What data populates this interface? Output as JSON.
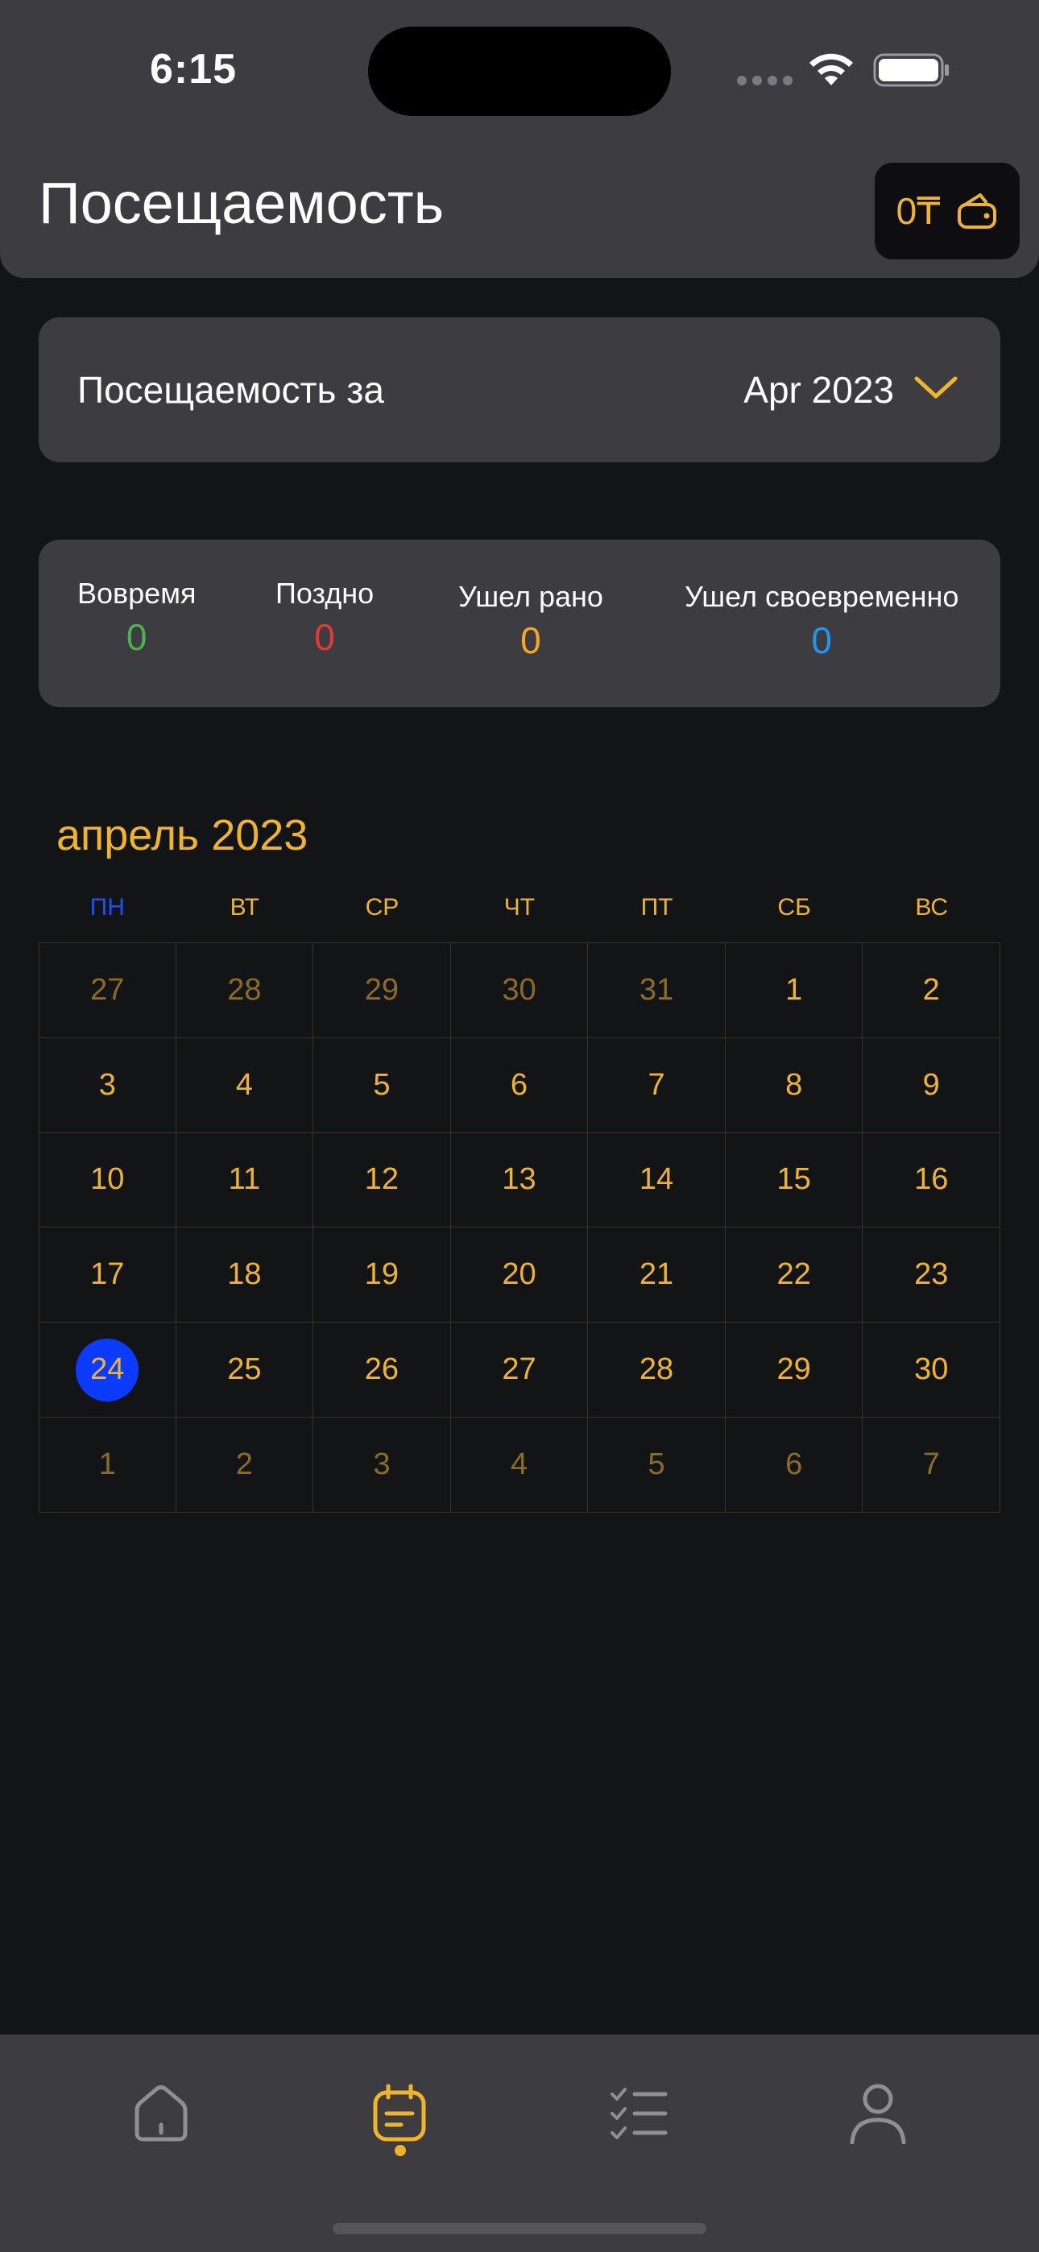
{
  "status_bar": {
    "time": "6:15"
  },
  "header": {
    "title": "Посещаемость",
    "wallet_amount": "0₸",
    "wallet_icon": "wallet-icon"
  },
  "period": {
    "label": "Посещаемость за",
    "value": "Apr 2023",
    "icon": "chevron-down-icon"
  },
  "stats": [
    {
      "label": "Вовремя",
      "value": "0",
      "color": "#4caf50"
    },
    {
      "label": "Поздно",
      "value": "0",
      "color": "#e53935"
    },
    {
      "label": "Ушел рано",
      "value": "0",
      "color": "#f5a623"
    },
    {
      "label": "Ушел своевременно",
      "value": "0",
      "color": "#2196f3"
    }
  ],
  "calendar": {
    "title": "апрель 2023",
    "weekdays": [
      "ПН",
      "ВТ",
      "СР",
      "ЧТ",
      "ПТ",
      "СБ",
      "ВС"
    ],
    "days": [
      {
        "d": "27",
        "dim": true
      },
      {
        "d": "28",
        "dim": true
      },
      {
        "d": "29",
        "dim": true
      },
      {
        "d": "30",
        "dim": true
      },
      {
        "d": "31",
        "dim": true
      },
      {
        "d": "1"
      },
      {
        "d": "2"
      },
      {
        "d": "3"
      },
      {
        "d": "4"
      },
      {
        "d": "5"
      },
      {
        "d": "6"
      },
      {
        "d": "7"
      },
      {
        "d": "8"
      },
      {
        "d": "9"
      },
      {
        "d": "10"
      },
      {
        "d": "11"
      },
      {
        "d": "12"
      },
      {
        "d": "13"
      },
      {
        "d": "14"
      },
      {
        "d": "15"
      },
      {
        "d": "16"
      },
      {
        "d": "17"
      },
      {
        "d": "18"
      },
      {
        "d": "19"
      },
      {
        "d": "20"
      },
      {
        "d": "21"
      },
      {
        "d": "22"
      },
      {
        "d": "23"
      },
      {
        "d": "24",
        "today": true
      },
      {
        "d": "25"
      },
      {
        "d": "26"
      },
      {
        "d": "27"
      },
      {
        "d": "28"
      },
      {
        "d": "29"
      },
      {
        "d": "30"
      },
      {
        "d": "1",
        "dim": true
      },
      {
        "d": "2",
        "dim": true
      },
      {
        "d": "3",
        "dim": true
      },
      {
        "d": "4",
        "dim": true
      },
      {
        "d": "5",
        "dim": true
      },
      {
        "d": "6",
        "dim": true
      },
      {
        "d": "7",
        "dim": true
      }
    ],
    "accent_color": "#f0b429",
    "today_color": "#0a3bff"
  },
  "tabbar": {
    "tabs": [
      {
        "icon": "home-icon",
        "active": false
      },
      {
        "icon": "attendance-icon",
        "active": true
      },
      {
        "icon": "tasks-list-icon",
        "active": false
      },
      {
        "icon": "profile-icon",
        "active": false
      }
    ]
  }
}
